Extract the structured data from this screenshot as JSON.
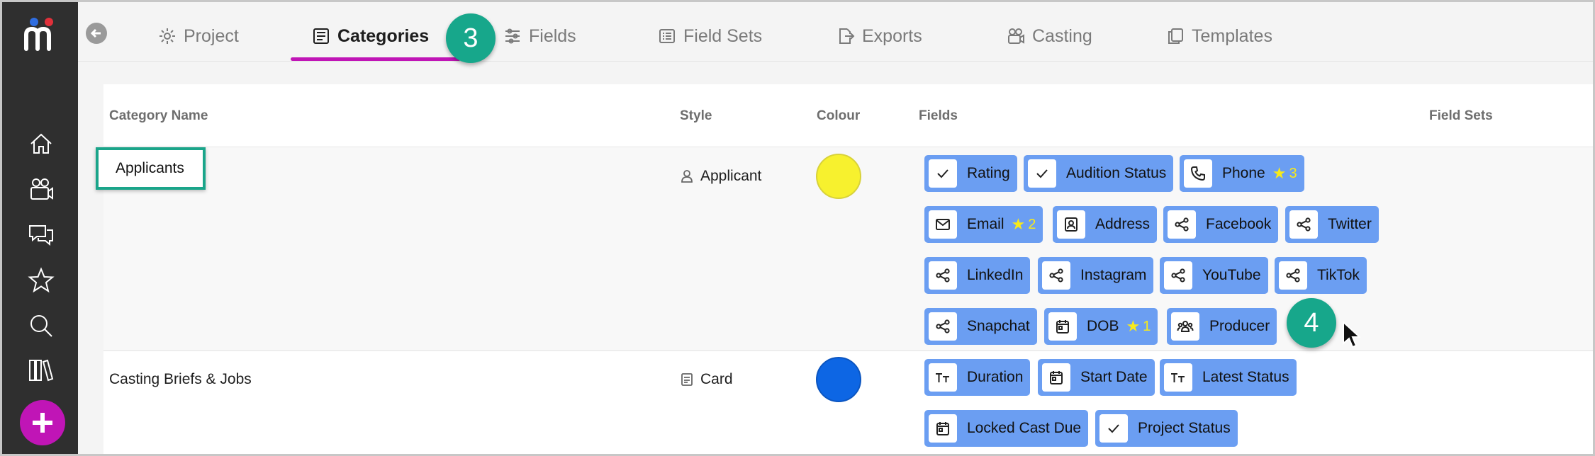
{
  "tabs": [
    {
      "label": "Project",
      "icon": "gear-icon"
    },
    {
      "label": "Categories",
      "icon": "categories-icon"
    },
    {
      "label": "Fields",
      "icon": "sliders-icon"
    },
    {
      "label": "Field Sets",
      "icon": "list-icon"
    },
    {
      "label": "Exports",
      "icon": "export-icon"
    },
    {
      "label": "Casting",
      "icon": "camera-icon"
    },
    {
      "label": "Templates",
      "icon": "copy-icon"
    }
  ],
  "active_tab": "Categories",
  "step_badges": [
    "3",
    "4"
  ],
  "table": {
    "headers": {
      "name": "Category Name",
      "style": "Style",
      "colour": "Colour",
      "fields": "Fields",
      "field_sets": "Field Sets"
    },
    "rows": [
      {
        "name": "Applicants",
        "style": "Applicant",
        "style_icon": "person-icon",
        "colour": "#f7f12e",
        "fields": [
          {
            "label": "Rating",
            "icon": "check-icon"
          },
          {
            "label": "Audition Status",
            "icon": "check-icon"
          },
          {
            "label": "Phone",
            "icon": "phone-icon",
            "count": "3"
          },
          {
            "label": "Email",
            "icon": "mail-icon",
            "count": "2"
          },
          {
            "label": "Address",
            "icon": "contact-icon"
          },
          {
            "label": "Facebook",
            "icon": "share-icon"
          },
          {
            "label": "Twitter",
            "icon": "share-icon"
          },
          {
            "label": "LinkedIn",
            "icon": "share-icon"
          },
          {
            "label": "Instagram",
            "icon": "share-icon"
          },
          {
            "label": "YouTube",
            "icon": "share-icon"
          },
          {
            "label": "TikTok",
            "icon": "share-icon"
          },
          {
            "label": "Snapchat",
            "icon": "share-icon"
          },
          {
            "label": "DOB",
            "icon": "calendar-icon",
            "count": "1"
          },
          {
            "label": "Producer",
            "icon": "people-icon"
          }
        ]
      },
      {
        "name": "Casting Briefs & Jobs",
        "style": "Card",
        "style_icon": "card-icon",
        "colour": "#0d66e4",
        "fields": [
          {
            "label": "Duration",
            "icon": "text-icon"
          },
          {
            "label": "Start Date",
            "icon": "calendar-icon"
          },
          {
            "label": "Latest Status",
            "icon": "text-icon"
          },
          {
            "label": "Locked Cast Due",
            "icon": "calendar-icon"
          },
          {
            "label": "Project Status",
            "icon": "check-icon"
          }
        ]
      }
    ]
  }
}
